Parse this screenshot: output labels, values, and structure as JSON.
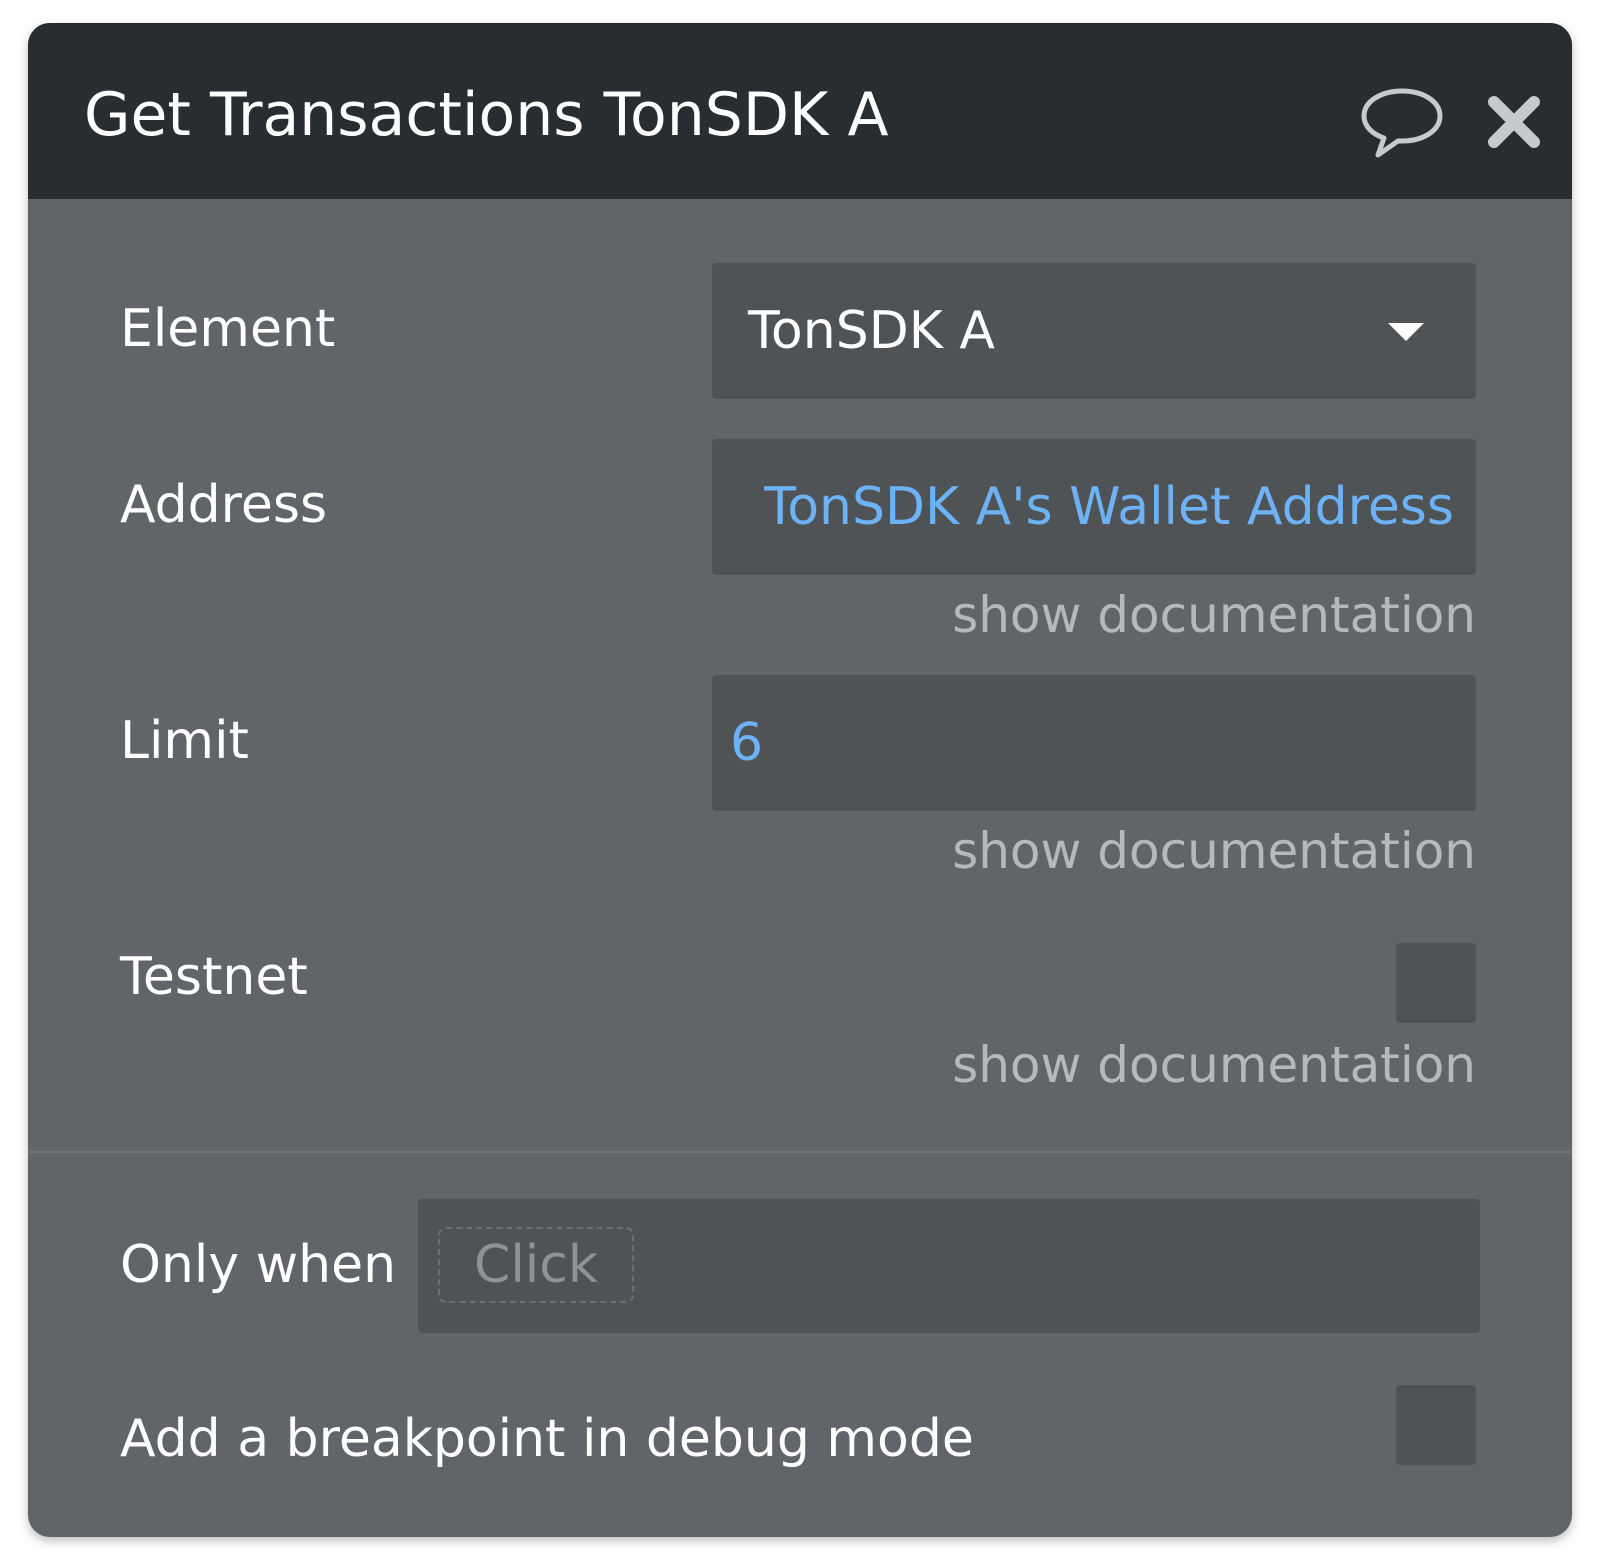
{
  "header": {
    "title": "Get Transactions TonSDK A",
    "comment_icon": "speech-bubble-icon",
    "close_icon": "close-x-icon"
  },
  "fields": {
    "element": {
      "label": "Element",
      "value": "TonSDK A"
    },
    "address": {
      "label": "Address",
      "value": "TonSDK A's Wallet Address",
      "doc_link": "show documentation"
    },
    "limit": {
      "label": "Limit",
      "value": "6",
      "doc_link": "show documentation"
    },
    "testnet": {
      "label": "Testnet",
      "checked": false,
      "doc_link": "show documentation"
    }
  },
  "condition": {
    "label": "Only when",
    "placeholder": "Click"
  },
  "breakpoint": {
    "label": "Add a breakpoint in debug mode",
    "checked": false
  },
  "colors": {
    "header_bg": "#272d30",
    "panel_bg": "#616569",
    "field_bg": "#4f5356",
    "dynamic_value": "#6cb2f5",
    "doc_link": "#b6b9bc"
  }
}
